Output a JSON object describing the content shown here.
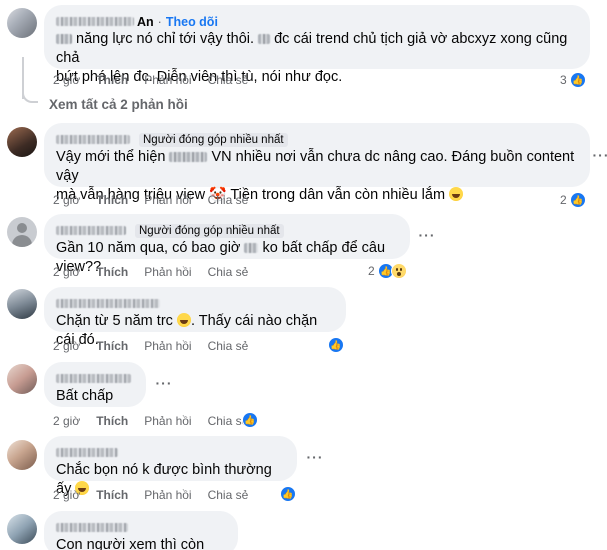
{
  "actions": {
    "time": "2 giờ",
    "like": "Thích",
    "reply": "Phản hồi",
    "share": "Chia sẻ"
  },
  "badge": "Người đóng góp nhiều nhất",
  "view_replies": "Xem tất cả 2 phản hồi",
  "comments": [
    {
      "author_suffix": "An",
      "follow": "Theo dõi",
      "line1": "năng lực nó chỉ tới vậy thôi.",
      "line1b": "đc cái trend chủ tịch giả vờ abcxyz xong cũng chả",
      "line2": "bứt phá lên đc. Diễn viên thì tù, nói như đọc.",
      "reactions": "3"
    },
    {
      "line1a": "Vậy mới thể hiện",
      "line1b": "VN nhiều nơi vẫn chưa dc nâng cao. Đáng buồn content vậy",
      "line2a": "mà vẫn hàng triệu view",
      "line2b": "Tiền trong dân vẫn còn nhiều lắm",
      "reactions": "2"
    },
    {
      "line1a": "Gần 10 năm qua, có bao giờ",
      "line1b": "ko bất chấp để câu view??",
      "reactions": "2"
    },
    {
      "line1a": "Chặn từ 5 năm trc",
      "line1b": ". Thấy cái nào chặn cái đó."
    },
    {
      "line1": "Bất chấp"
    },
    {
      "line1": "Chắc bọn nó k được bình thường ấy"
    },
    {
      "line1": "Con người xem thì còn làm :))"
    }
  ],
  "icons": {
    "like": "like-reaction-icon",
    "wow": "wow-reaction-icon",
    "laugh": "laughing-emoji",
    "more": "more-options-icon"
  },
  "colors": {
    "bubble": "#f0f2f5",
    "link": "#1877f2",
    "muted": "#65676b"
  }
}
